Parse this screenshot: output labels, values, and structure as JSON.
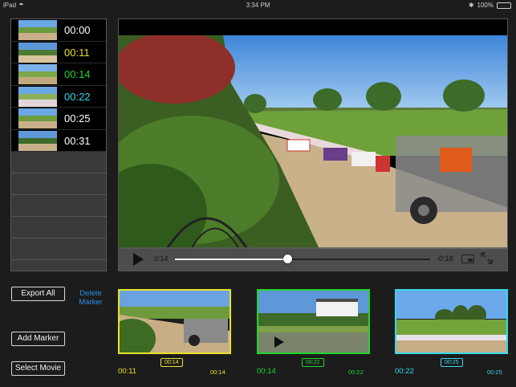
{
  "status_bar": {
    "device": "iPad",
    "time": "3:34 PM",
    "battery": "100%"
  },
  "colors": {
    "yellow": "#e8e22a",
    "green": "#22d62c",
    "cyan": "#38d9e8",
    "white": "#ffffff",
    "link": "#2b8fe8"
  },
  "markers": [
    {
      "time": "00:00",
      "color": "#ffffff"
    },
    {
      "time": "00:11",
      "color": "#e8e22a"
    },
    {
      "time": "00:14",
      "color": "#22d62c"
    },
    {
      "time": "00:22",
      "color": "#38d9e8"
    },
    {
      "time": "00:25",
      "color": "#ffffff"
    },
    {
      "time": "00:31",
      "color": "#ffffff"
    }
  ],
  "player": {
    "elapsed": "0:14",
    "remaining": "-0:18",
    "progress": 0.44
  },
  "buttons": {
    "export_all": "Export All",
    "delete_marker": "Delete Marker",
    "add_marker": "Add Marker",
    "select_movie": "Select Movie"
  },
  "clips": [
    {
      "start": "00:11",
      "end": "00:14",
      "color": "#e8e22a"
    },
    {
      "start": "00:14",
      "end": "00:22",
      "color": "#22d62c"
    },
    {
      "start": "00:22",
      "end": "00:25",
      "color": "#38d9e8"
    }
  ]
}
